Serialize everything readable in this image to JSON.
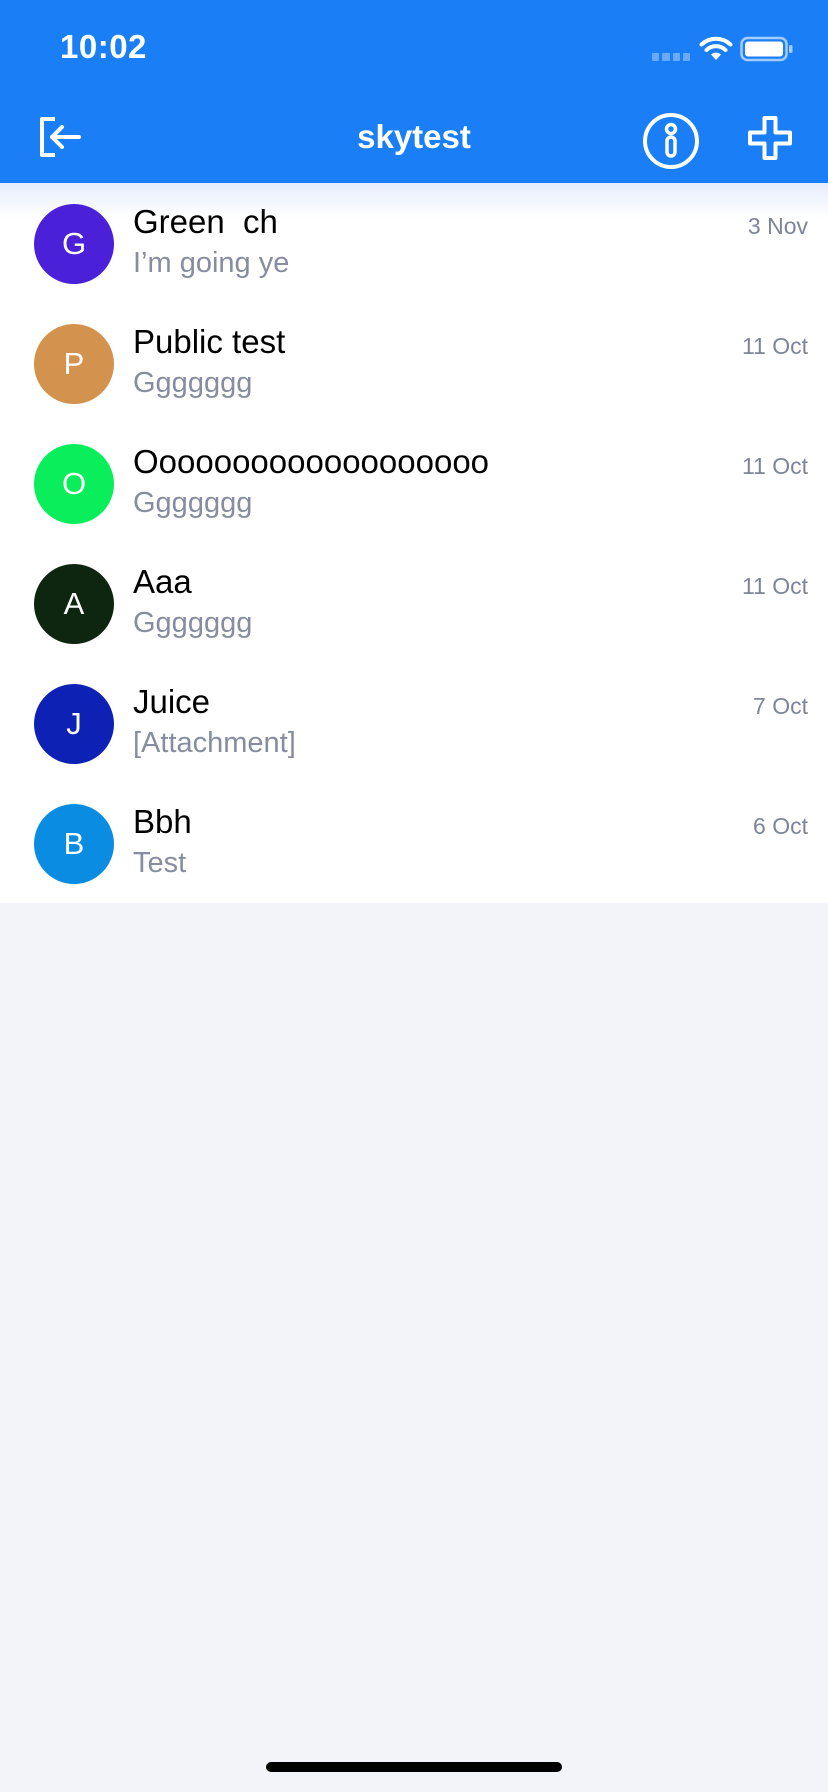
{
  "status_bar": {
    "time": "10:02"
  },
  "nav": {
    "title": "skytest"
  },
  "chats": [
    {
      "initial": "G",
      "avatar_color": "#4a20d8",
      "name": "Green  ch",
      "preview": "I’m going ye",
      "date": "3 Nov"
    },
    {
      "initial": "P",
      "avatar_color": "#d3924d",
      "name": "Public test",
      "preview": "Ggggggg",
      "date": "11 Oct"
    },
    {
      "initial": "O",
      "avatar_color": "#0aee5c",
      "name": "Ooooooooooooooooooo",
      "preview": "Ggggggg",
      "date": "11 Oct"
    },
    {
      "initial": "A",
      "avatar_color": "#0e2610",
      "name": "Aaa",
      "preview": "Ggggggg",
      "date": "11 Oct"
    },
    {
      "initial": "J",
      "avatar_color": "#0d22b4",
      "name": "Juice",
      "preview": "[Attachment]",
      "date": "7 Oct"
    },
    {
      "initial": "B",
      "avatar_color": "#0a8ce2",
      "name": "Bbh",
      "preview": "Test",
      "date": "6 Oct"
    }
  ],
  "colors": {
    "header_blue": "#1a7ff7",
    "preview_gray": "#858d9e",
    "background": "#f2f4f9"
  }
}
